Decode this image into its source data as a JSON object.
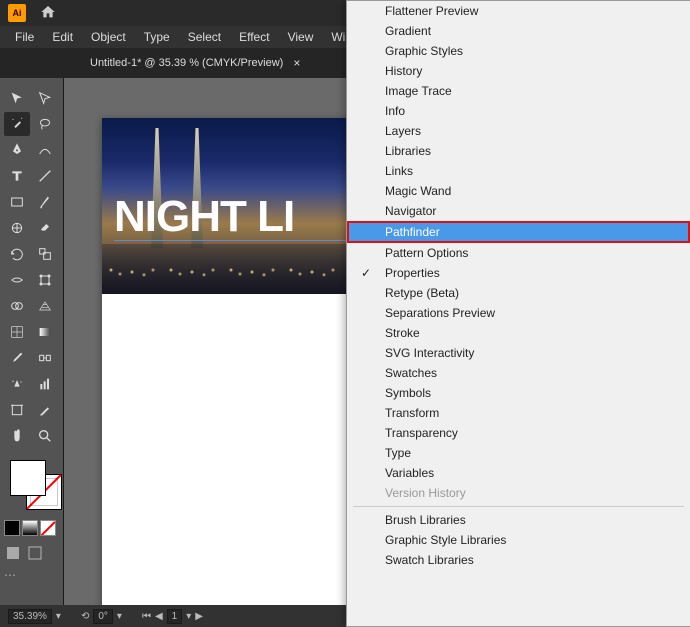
{
  "titleBar": {
    "appLogo": "Ai"
  },
  "menuBar": {
    "items": [
      "File",
      "Edit",
      "Object",
      "Type",
      "Select",
      "Effect",
      "View",
      "Window"
    ]
  },
  "tab": {
    "title": "Untitled-1* @ 35.39 % (CMYK/Preview)",
    "close": "×"
  },
  "canvas": {
    "text": "NIGHT LI"
  },
  "statusBar": {
    "zoom": "35.39%",
    "rotate": "0°",
    "page": "1"
  },
  "windowMenu": {
    "items": [
      {
        "label": "Flattener Preview",
        "checked": false
      },
      {
        "label": "Gradient",
        "checked": false
      },
      {
        "label": "Graphic Styles",
        "checked": false
      },
      {
        "label": "History",
        "checked": false
      },
      {
        "label": "Image Trace",
        "checked": false
      },
      {
        "label": "Info",
        "checked": false
      },
      {
        "label": "Layers",
        "checked": false
      },
      {
        "label": "Libraries",
        "checked": false
      },
      {
        "label": "Links",
        "checked": false
      },
      {
        "label": "Magic Wand",
        "checked": false
      },
      {
        "label": "Navigator",
        "checked": false
      },
      {
        "label": "Pathfinder",
        "checked": false,
        "highlighted": true
      },
      {
        "label": "Pattern Options",
        "checked": false
      },
      {
        "label": "Properties",
        "checked": true
      },
      {
        "label": "Retype (Beta)",
        "checked": false
      },
      {
        "label": "Separations Preview",
        "checked": false
      },
      {
        "label": "Stroke",
        "checked": false
      },
      {
        "label": "SVG Interactivity",
        "checked": false
      },
      {
        "label": "Swatches",
        "checked": false
      },
      {
        "label": "Symbols",
        "checked": false
      },
      {
        "label": "Transform",
        "checked": false
      },
      {
        "label": "Transparency",
        "checked": false
      },
      {
        "label": "Type",
        "checked": false
      },
      {
        "label": "Variables",
        "checked": false
      },
      {
        "label": "Version History",
        "checked": false,
        "disabled": true
      }
    ],
    "librarySection": [
      {
        "label": "Brush Libraries"
      },
      {
        "label": "Graphic Style Libraries"
      },
      {
        "label": "Swatch Libraries"
      }
    ]
  }
}
